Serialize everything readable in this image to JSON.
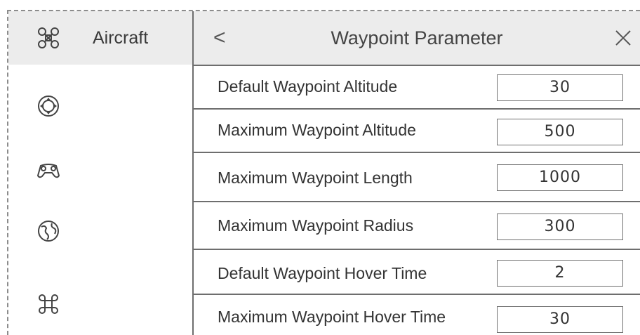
{
  "sidebar": {
    "items": [
      {
        "icon": "drone-icon",
        "label": "Aircraft"
      },
      {
        "icon": "dpad-icon",
        "label": ""
      },
      {
        "icon": "gamepad-icon",
        "label": ""
      },
      {
        "icon": "globe-icon",
        "label": ""
      },
      {
        "icon": "command-icon",
        "label": ""
      }
    ]
  },
  "header": {
    "back": "<",
    "title": "Waypoint Parameter",
    "close": "×"
  },
  "params": [
    {
      "label": "Default Waypoint Altitude",
      "value": "30"
    },
    {
      "label": "Maximum Waypoint Altitude",
      "value": "500"
    },
    {
      "label": "Maximum Waypoint Length",
      "value": "1000"
    },
    {
      "label": "Maximum Waypoint Radius",
      "value": "300"
    },
    {
      "label": "Default Waypoint Hover Time",
      "value": "2"
    },
    {
      "label": "Maximum Waypoint Hover Time",
      "value": "30"
    }
  ],
  "colors": {
    "border": "#6e6e6e",
    "dashed_border": "#8c8c8c",
    "active_bg": "#ececec",
    "text": "#3a3a3a"
  }
}
